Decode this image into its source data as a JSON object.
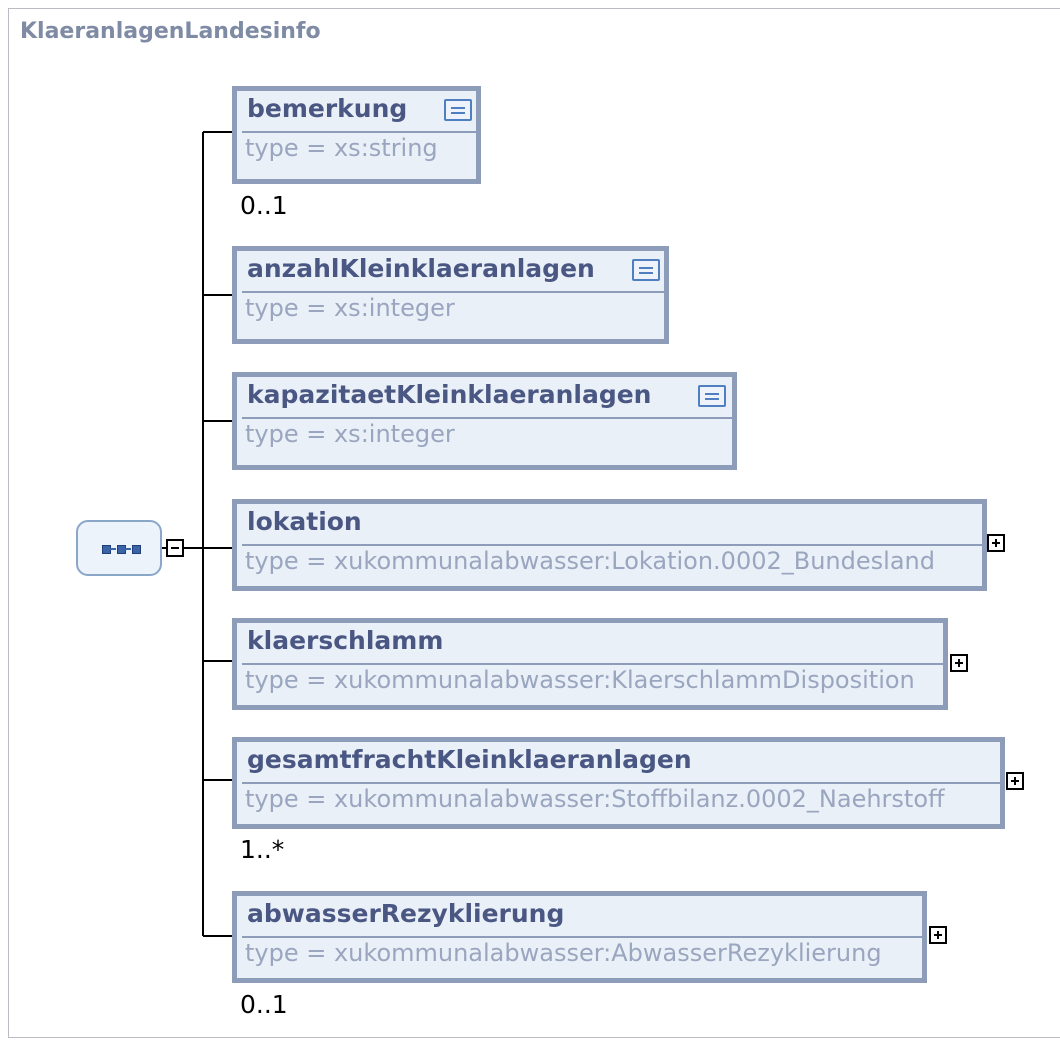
{
  "diagram": {
    "title": "KlaeranlagenLandesinfo",
    "compositor": "sequence",
    "elements": [
      {
        "name": "bemerkung",
        "type": "type = xs:string",
        "cardinality": "0..1",
        "has_doc": true,
        "expandable": false
      },
      {
        "name": "anzahlKleinklaeranlagen",
        "type": "type = xs:integer",
        "cardinality": "",
        "has_doc": true,
        "expandable": false
      },
      {
        "name": "kapazitaetKleinklaeranlagen",
        "type": "type = xs:integer",
        "cardinality": "",
        "has_doc": true,
        "expandable": false
      },
      {
        "name": "lokation",
        "type": "type = xukommunalabwasser:Lokation.0002_Bundesland",
        "cardinality": "",
        "has_doc": false,
        "expandable": true
      },
      {
        "name": "klaerschlamm",
        "type": "type = xukommunalabwasser:KlaerschlammDisposition",
        "cardinality": "",
        "has_doc": false,
        "expandable": true
      },
      {
        "name": "gesamtfrachtKleinklaeranlagen",
        "type": "type = xukommunalabwasser:Stoffbilanz.0002_Naehrstoff",
        "cardinality": "1..*",
        "has_doc": false,
        "expandable": true
      },
      {
        "name": "abwasserRezyklierung",
        "type": "type = xukommunalabwasser:AbwasserRezyklierung",
        "cardinality": "0..1",
        "has_doc": false,
        "expandable": true
      }
    ]
  },
  "colors": {
    "node_fill": "#eaf0f8",
    "node_border": "#8c9cb9",
    "name_text": "#4a5783",
    "type_text": "#9aa6bf",
    "doc_icon": "#4f7fc1"
  },
  "icons": {
    "collapse": "minus-box-icon",
    "expand": "plus-box-icon",
    "documentation": "documentation-icon",
    "sequence": "sequence-compositor-icon"
  }
}
